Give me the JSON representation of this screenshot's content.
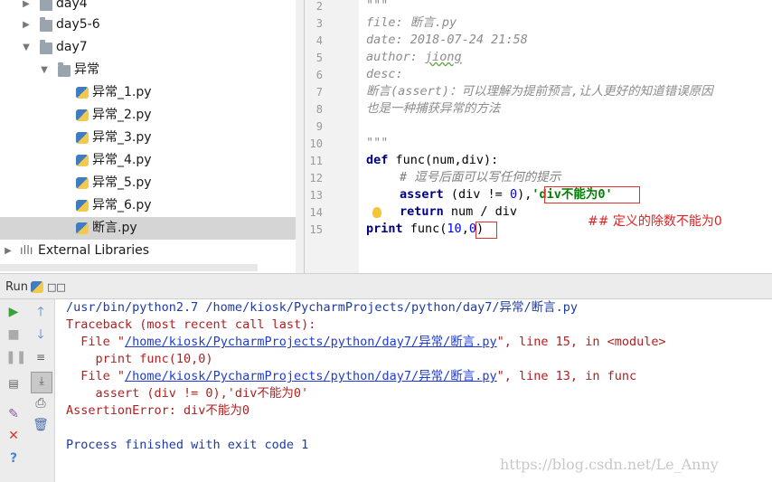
{
  "tree": {
    "items": [
      {
        "label": "day4",
        "kind": "folder"
      },
      {
        "label": "day5-6",
        "kind": "folder"
      },
      {
        "label": "day7",
        "kind": "folder"
      },
      {
        "label": "异常",
        "kind": "folder"
      },
      {
        "label": "异常_1.py",
        "kind": "py"
      },
      {
        "label": "异常_2.py",
        "kind": "py"
      },
      {
        "label": "异常_3.py",
        "kind": "py"
      },
      {
        "label": "异常_4.py",
        "kind": "py"
      },
      {
        "label": "异常_5.py",
        "kind": "py"
      },
      {
        "label": "异常_6.py",
        "kind": "py"
      },
      {
        "label": "断言.py",
        "kind": "py"
      },
      {
        "label": "External Libraries",
        "kind": "lib"
      }
    ]
  },
  "editor": {
    "line_numbers": [
      "2",
      "3",
      "4",
      "5",
      "6",
      "7",
      "8",
      "9",
      "10",
      "11",
      "12",
      "13",
      "14",
      "15"
    ],
    "code": {
      "l2": "\"\"\"",
      "l3": "file: 断言.py",
      "l4": "date: 2018-07-24 21:58",
      "l5_key": "author: ",
      "l5_val": "jiong",
      "l6": "desc:",
      "l7": "断言(assert)：可以理解为提前预言,让人更好的知道错误原因",
      "l8": "也是一种捕获异常的方法",
      "l10": "\"\"\"",
      "l11_kw": "def",
      "l11_rest": " func(num,div):",
      "l12": "# 逗号后面可以写任何的提示",
      "l13_kw": "assert",
      "l13_a": " (div != ",
      "l13_num": "0",
      "l13_b": "),",
      "l13_str": "'div不能为0'",
      "l14_kw": "return",
      "l14_rest": " num / div",
      "l15_kw": "print",
      "l15_a": " func(",
      "l15_num1": "10",
      "l15_comma": ",",
      "l15_num2": "0",
      "l15_close": ")"
    },
    "annotation": "## 定义的除数不能为0"
  },
  "run": {
    "tab_label": "Run",
    "tab_icon": "python-icon",
    "tab_name": "□□",
    "console": {
      "cmd": "/usr/bin/python2.7 /home/kiosk/PycharmProjects/python/day7/异常/断言.py",
      "tb_header": "Traceback (most recent call last):",
      "f1_pre": "  File \"",
      "f1_link": "/home/kiosk/PycharmProjects/python/day7/异常/断言.py",
      "f1_post": "\", line 15, in <module>",
      "f1_code": "    print func(10,0)",
      "f2_pre": "  File \"",
      "f2_link": "/home/kiosk/PycharmProjects/python/day7/异常/断言.py",
      "f2_post": "\", line 13, in func",
      "f2_code": "    assert (div != 0),'div不能为0'",
      "error": "AssertionError: div不能为0",
      "exit": "Process finished with exit code 1"
    }
  },
  "watermark": "https://blog.csdn.net/Le_Anny"
}
